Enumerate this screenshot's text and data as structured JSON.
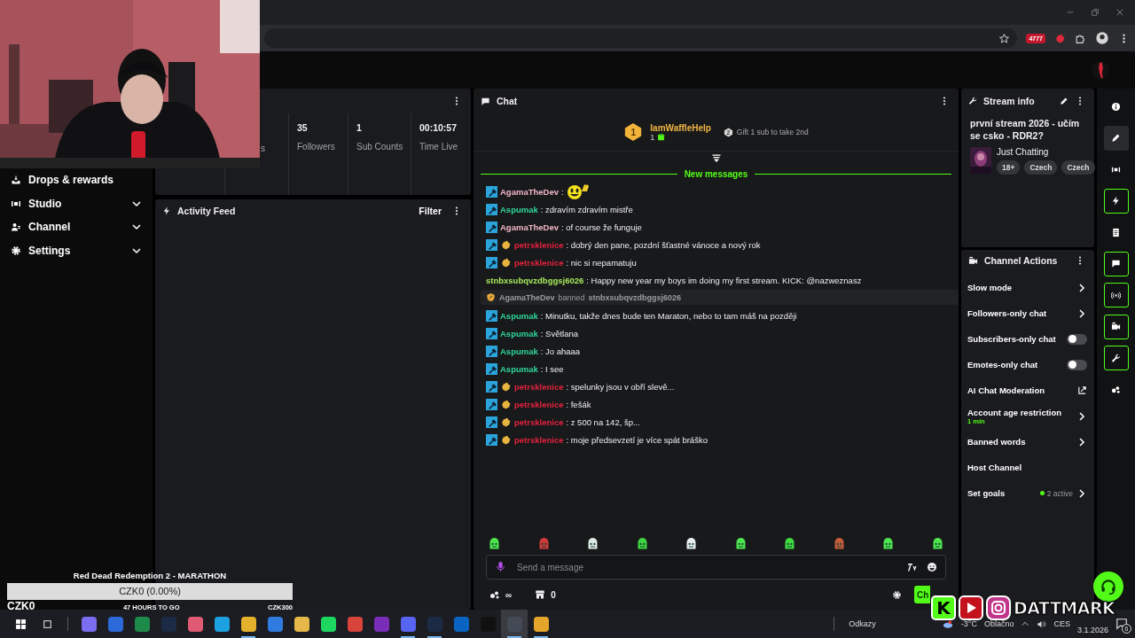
{
  "browser": {
    "extension_badge": "4777"
  },
  "sidebar": {
    "items": [
      {
        "label": "Drops & rewards",
        "kind": "link"
      },
      {
        "label": "Studio",
        "kind": "menu"
      },
      {
        "label": "Channel",
        "kind": "menu"
      },
      {
        "label": "Settings",
        "kind": "menu"
      }
    ]
  },
  "stats": [
    {
      "label": "s"
    },
    {
      "value": "35",
      "label": "Followers"
    },
    {
      "value": "1",
      "label": "Sub Counts"
    },
    {
      "value": "00:10:57",
      "label": "Time Live"
    }
  ],
  "activity_feed": {
    "title": "Activity Feed",
    "filter": "Filter"
  },
  "chat": {
    "title": "Chat",
    "top_gifter": {
      "rank": "1",
      "name": "IamWaffleHelp",
      "count": "1",
      "next_rank": "2",
      "next_text": "Gift 1 sub to take 2nd"
    },
    "new_messages": "New messages",
    "messages": [
      {
        "kind": "message",
        "mod": true,
        "gifter": false,
        "user": "AgamaTheDev",
        "color": "#f4b6c8",
        "text": ":",
        "emote": true
      },
      {
        "kind": "message",
        "mod": true,
        "gifter": false,
        "user": "Aspumak",
        "color": "#2fd69a",
        "text": ": zdravím zdravím mistře",
        "emote": false
      },
      {
        "kind": "message",
        "mod": true,
        "gifter": false,
        "user": "AgamaTheDev",
        "color": "#f4b6c8",
        "text": ": of course že funguje",
        "emote": false
      },
      {
        "kind": "message",
        "mod": true,
        "gifter": true,
        "user": "petrsklenice",
        "color": "#e3223f",
        "text": ": dobrý den pane, pozdní šťastné vánoce a nový rok",
        "emote": false
      },
      {
        "kind": "message",
        "mod": true,
        "gifter": true,
        "user": "petrsklenice",
        "color": "#e3223f",
        "text": ": nic si nepamatuju",
        "emote": false
      },
      {
        "kind": "message",
        "mod": false,
        "gifter": false,
        "user": "stnbxsubqvzdbggsj6026",
        "color": "#a8e85c",
        "text": ": Happy new year my boys im doing my first stream. KICK: @nazweznasz",
        "emote": false
      },
      {
        "kind": "ban",
        "moderator": "AgamaTheDev",
        "action": "banned",
        "target": "stnbxsubqvzdbggsj6026"
      },
      {
        "kind": "message",
        "mod": true,
        "gifter": false,
        "user": "Aspumak",
        "color": "#2fd69a",
        "text": ": Minutku, takže dnes bude ten Maraton, nebo to tam máš na později",
        "emote": false
      },
      {
        "kind": "message",
        "mod": true,
        "gifter": false,
        "user": "Aspumak",
        "color": "#2fd69a",
        "text": ": Světlana",
        "emote": false
      },
      {
        "kind": "message",
        "mod": true,
        "gifter": false,
        "user": "Aspumak",
        "color": "#2fd69a",
        "text": ": Jo ahaaa",
        "emote": false
      },
      {
        "kind": "message",
        "mod": true,
        "gifter": false,
        "user": "Aspumak",
        "color": "#2fd69a",
        "text": ": I see",
        "emote": false
      },
      {
        "kind": "message",
        "mod": true,
        "gifter": true,
        "user": "petrsklenice",
        "color": "#e3223f",
        "text": ": spelunky jsou v obří slevě...",
        "emote": false
      },
      {
        "kind": "message",
        "mod": true,
        "gifter": true,
        "user": "petrsklenice",
        "color": "#e3223f",
        "text": ": fešák",
        "emote": false
      },
      {
        "kind": "message",
        "mod": true,
        "gifter": true,
        "user": "petrsklenice",
        "color": "#e3223f",
        "text": ": z 500 na 142, šp...",
        "emote": false
      },
      {
        "kind": "message",
        "mod": true,
        "gifter": true,
        "user": "petrsklenice",
        "color": "#e3223f",
        "text": ": moje předsevzetí je více spát bráško",
        "emote": false
      }
    ],
    "input": {
      "placeholder": "Send a message"
    },
    "points": "∞",
    "store_count": "0",
    "send_button": "Ch"
  },
  "stream_info": {
    "title": "Stream info",
    "stream_title": "první stream 2026 - učím se csko - RDR2?",
    "category": "Just Chatting",
    "tags": [
      "18+",
      "Czech",
      "Czech"
    ]
  },
  "channel_actions": {
    "title": "Channel Actions",
    "items": [
      {
        "kind": "link",
        "label": "Slow mode"
      },
      {
        "kind": "link",
        "label": "Followers-only chat"
      },
      {
        "kind": "toggle",
        "label": "Subscribers-only chat",
        "on": false
      },
      {
        "kind": "toggle",
        "label": "Emotes-only chat",
        "on": false
      },
      {
        "kind": "external",
        "label": "AI Chat Moderation"
      },
      {
        "kind": "link",
        "label": "Account age restriction",
        "detail": "1 min"
      },
      {
        "kind": "link",
        "label": "Banned words"
      },
      {
        "kind": "plain",
        "label": "Host Channel"
      },
      {
        "kind": "link",
        "label": "Set goals",
        "status": "2 active"
      }
    ]
  },
  "rail": [
    {
      "active": false,
      "selected": false
    },
    {
      "active": false,
      "selected": true
    },
    {
      "active": false,
      "selected": false
    },
    {
      "active": true,
      "selected": false
    },
    {
      "active": false,
      "selected": false
    },
    {
      "active": true,
      "selected": false
    },
    {
      "active": true,
      "selected": false
    },
    {
      "active": true,
      "selected": false
    },
    {
      "active": true,
      "selected": false
    },
    {
      "active": false,
      "selected": false
    }
  ],
  "goal": {
    "title": "Red Dead Redemption 2 - MARATHON",
    "level": 0,
    "bar_text": "CZK0 (0.00%)",
    "raised": "CZK0",
    "remaining": "47 HOURS TO GO",
    "target": "CZK300"
  },
  "social_overlay": {
    "logo_letter": "K",
    "name": "DATTMARK"
  },
  "taskbar": {
    "apps": [
      {
        "running": false,
        "selected": false
      },
      {
        "running": false,
        "selected": false
      },
      {
        "running": false,
        "selected": false
      },
      {
        "running": false,
        "selected": false
      },
      {
        "running": false,
        "selected": false
      },
      {
        "running": false,
        "selected": false
      },
      {
        "running": true,
        "selected": false
      },
      {
        "running": false,
        "selected": false
      },
      {
        "running": false,
        "selected": false
      },
      {
        "running": false,
        "selected": false
      },
      {
        "running": false,
        "selected": false
      },
      {
        "running": false,
        "selected": false
      },
      {
        "running": true,
        "selected": false
      },
      {
        "running": true,
        "selected": false
      },
      {
        "running": false,
        "selected": false
      },
      {
        "running": false,
        "selected": false
      },
      {
        "running": true,
        "selected": true
      },
      {
        "running": true,
        "selected": false
      }
    ],
    "links": "Odkazy",
    "temperature": "-3°C",
    "weather": "Oblačno",
    "language": "CES",
    "date": "3.1.2026",
    "notifications": "6"
  }
}
